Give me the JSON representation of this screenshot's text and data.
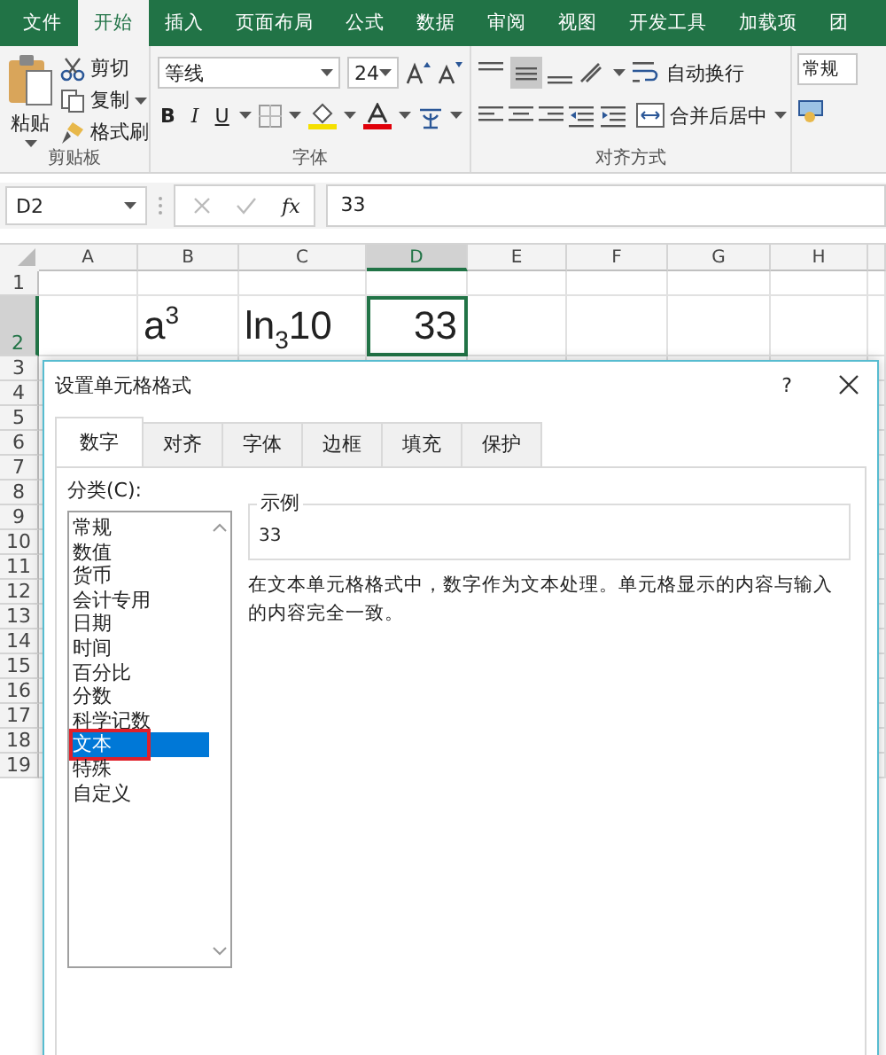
{
  "ribbon_tabs": [
    {
      "label": "文件",
      "selected": false
    },
    {
      "label": "开始",
      "selected": true
    },
    {
      "label": "插入",
      "selected": false
    },
    {
      "label": "页面布局",
      "selected": false
    },
    {
      "label": "公式",
      "selected": false
    },
    {
      "label": "数据",
      "selected": false
    },
    {
      "label": "审阅",
      "selected": false
    },
    {
      "label": "视图",
      "selected": false
    },
    {
      "label": "开发工具",
      "selected": false
    },
    {
      "label": "加载项",
      "selected": false
    },
    {
      "label": "团",
      "selected": false
    }
  ],
  "clipboard": {
    "paste": "粘贴",
    "cut": "剪切",
    "copy": "复制",
    "format_painter": "格式刷",
    "group": "剪贴板"
  },
  "font": {
    "name": "等线",
    "size": "24",
    "bold": "B",
    "italic": "I",
    "underline": "U",
    "group": "字体"
  },
  "alignment": {
    "wrap": "自动换行",
    "merge": "合并后居中",
    "group": "对齐方式"
  },
  "number": {
    "format": "常规"
  },
  "formula_bar": {
    "name_box": "D2",
    "function_label": "fx",
    "value": "33"
  },
  "columns": [
    {
      "label": "A",
      "selected": false
    },
    {
      "label": "B",
      "selected": false
    },
    {
      "label": "C",
      "selected": false
    },
    {
      "label": "D",
      "selected": true
    },
    {
      "label": "E",
      "selected": false
    },
    {
      "label": "F",
      "selected": false
    },
    {
      "label": "G",
      "selected": false
    },
    {
      "label": "H",
      "selected": false
    }
  ],
  "rows": [
    {
      "label": "1",
      "selected": false
    },
    {
      "label": "2",
      "selected": true,
      "cells": [
        {
          "kind": "blank"
        },
        {
          "kind": "text",
          "text": "a$^{3}$",
          "selected": false
        },
        {
          "kind": "text",
          "text": "ln$_{3}$10",
          "selected": false
        },
        {
          "kind": "number",
          "text": "33",
          "selected": true
        }
      ]
    },
    {
      "label": "3",
      "selected": false
    },
    {
      "label": "4",
      "selected": false
    },
    {
      "label": "5",
      "selected": false
    },
    {
      "label": "6",
      "selected": false
    },
    {
      "label": "7",
      "selected": false
    },
    {
      "label": "8",
      "selected": false
    },
    {
      "label": "9",
      "selected": false
    },
    {
      "label": "10",
      "selected": false
    },
    {
      "label": "11",
      "selected": false
    },
    {
      "label": "12",
      "selected": false
    },
    {
      "label": "13",
      "selected": false
    },
    {
      "label": "14",
      "selected": false
    },
    {
      "label": "15",
      "selected": false
    },
    {
      "label": "16",
      "selected": false
    },
    {
      "label": "17",
      "selected": false
    },
    {
      "label": "18",
      "selected": false
    },
    {
      "label": "19",
      "selected": false
    }
  ],
  "dialog": {
    "title": "设置单元格格式",
    "help": "?",
    "tabs": [
      {
        "label": "数字",
        "selected": true
      },
      {
        "label": "对齐",
        "selected": false
      },
      {
        "label": "字体",
        "selected": false
      },
      {
        "label": "边框",
        "selected": false
      },
      {
        "label": "填充",
        "selected": false
      },
      {
        "label": "保护",
        "selected": false
      }
    ],
    "category_label": "分类(C):",
    "categories": [
      {
        "label": "常规",
        "selected": false,
        "highlighted": false
      },
      {
        "label": "数值",
        "selected": false,
        "highlighted": false
      },
      {
        "label": "货币",
        "selected": false,
        "highlighted": false
      },
      {
        "label": "会计专用",
        "selected": false,
        "highlighted": false
      },
      {
        "label": "日期",
        "selected": false,
        "highlighted": false
      },
      {
        "label": "时间",
        "selected": false,
        "highlighted": false
      },
      {
        "label": "百分比",
        "selected": false,
        "highlighted": false
      },
      {
        "label": "分数",
        "selected": false,
        "highlighted": false
      },
      {
        "label": "科学记数",
        "selected": false,
        "highlighted": false
      },
      {
        "label": "文本",
        "selected": true,
        "highlighted": true
      },
      {
        "label": "特殊",
        "selected": false,
        "highlighted": false
      },
      {
        "label": "自定义",
        "selected": false,
        "highlighted": false
      }
    ],
    "sample": {
      "legend": "示例",
      "value": "33"
    },
    "description": "在文本单元格格式中，数字作为文本处理。单元格显示的内容与输入的内容完全一致。"
  }
}
